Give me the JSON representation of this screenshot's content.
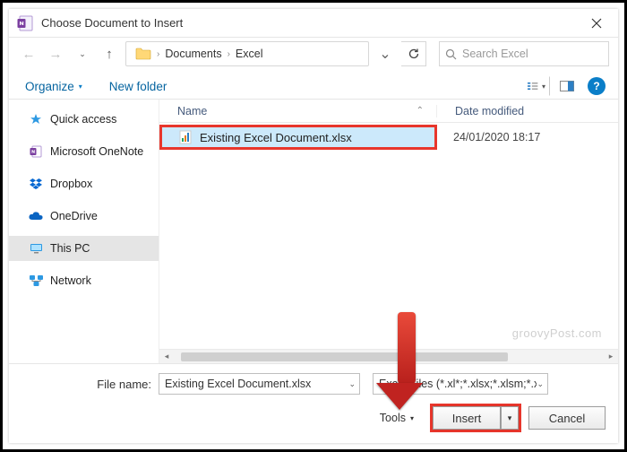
{
  "titlebar": {
    "title": "Choose Document to Insert"
  },
  "breadcrumb": {
    "parts": [
      "Documents",
      "Excel"
    ]
  },
  "search": {
    "placeholder": "Search Excel"
  },
  "toolbar": {
    "organize": "Organize",
    "newfolder": "New folder"
  },
  "sidebar": {
    "items": [
      {
        "label": "Quick access"
      },
      {
        "label": "Microsoft OneNote"
      },
      {
        "label": "Dropbox"
      },
      {
        "label": "OneDrive"
      },
      {
        "label": "This PC"
      },
      {
        "label": "Network"
      }
    ]
  },
  "columns": {
    "name": "Name",
    "date": "Date modified"
  },
  "files": {
    "rows": [
      {
        "name": "Existing Excel Document.xlsx",
        "date": "24/01/2020 18:17"
      }
    ]
  },
  "watermark": "groovyPost.com",
  "footer": {
    "filename_label": "File name:",
    "filename_value": "Existing Excel Document.xlsx",
    "filter_value": "Excel Files (*.xl*;*.xlsx;*.xlsm;*.xls",
    "tools": "Tools",
    "insert": "Insert",
    "cancel": "Cancel"
  }
}
